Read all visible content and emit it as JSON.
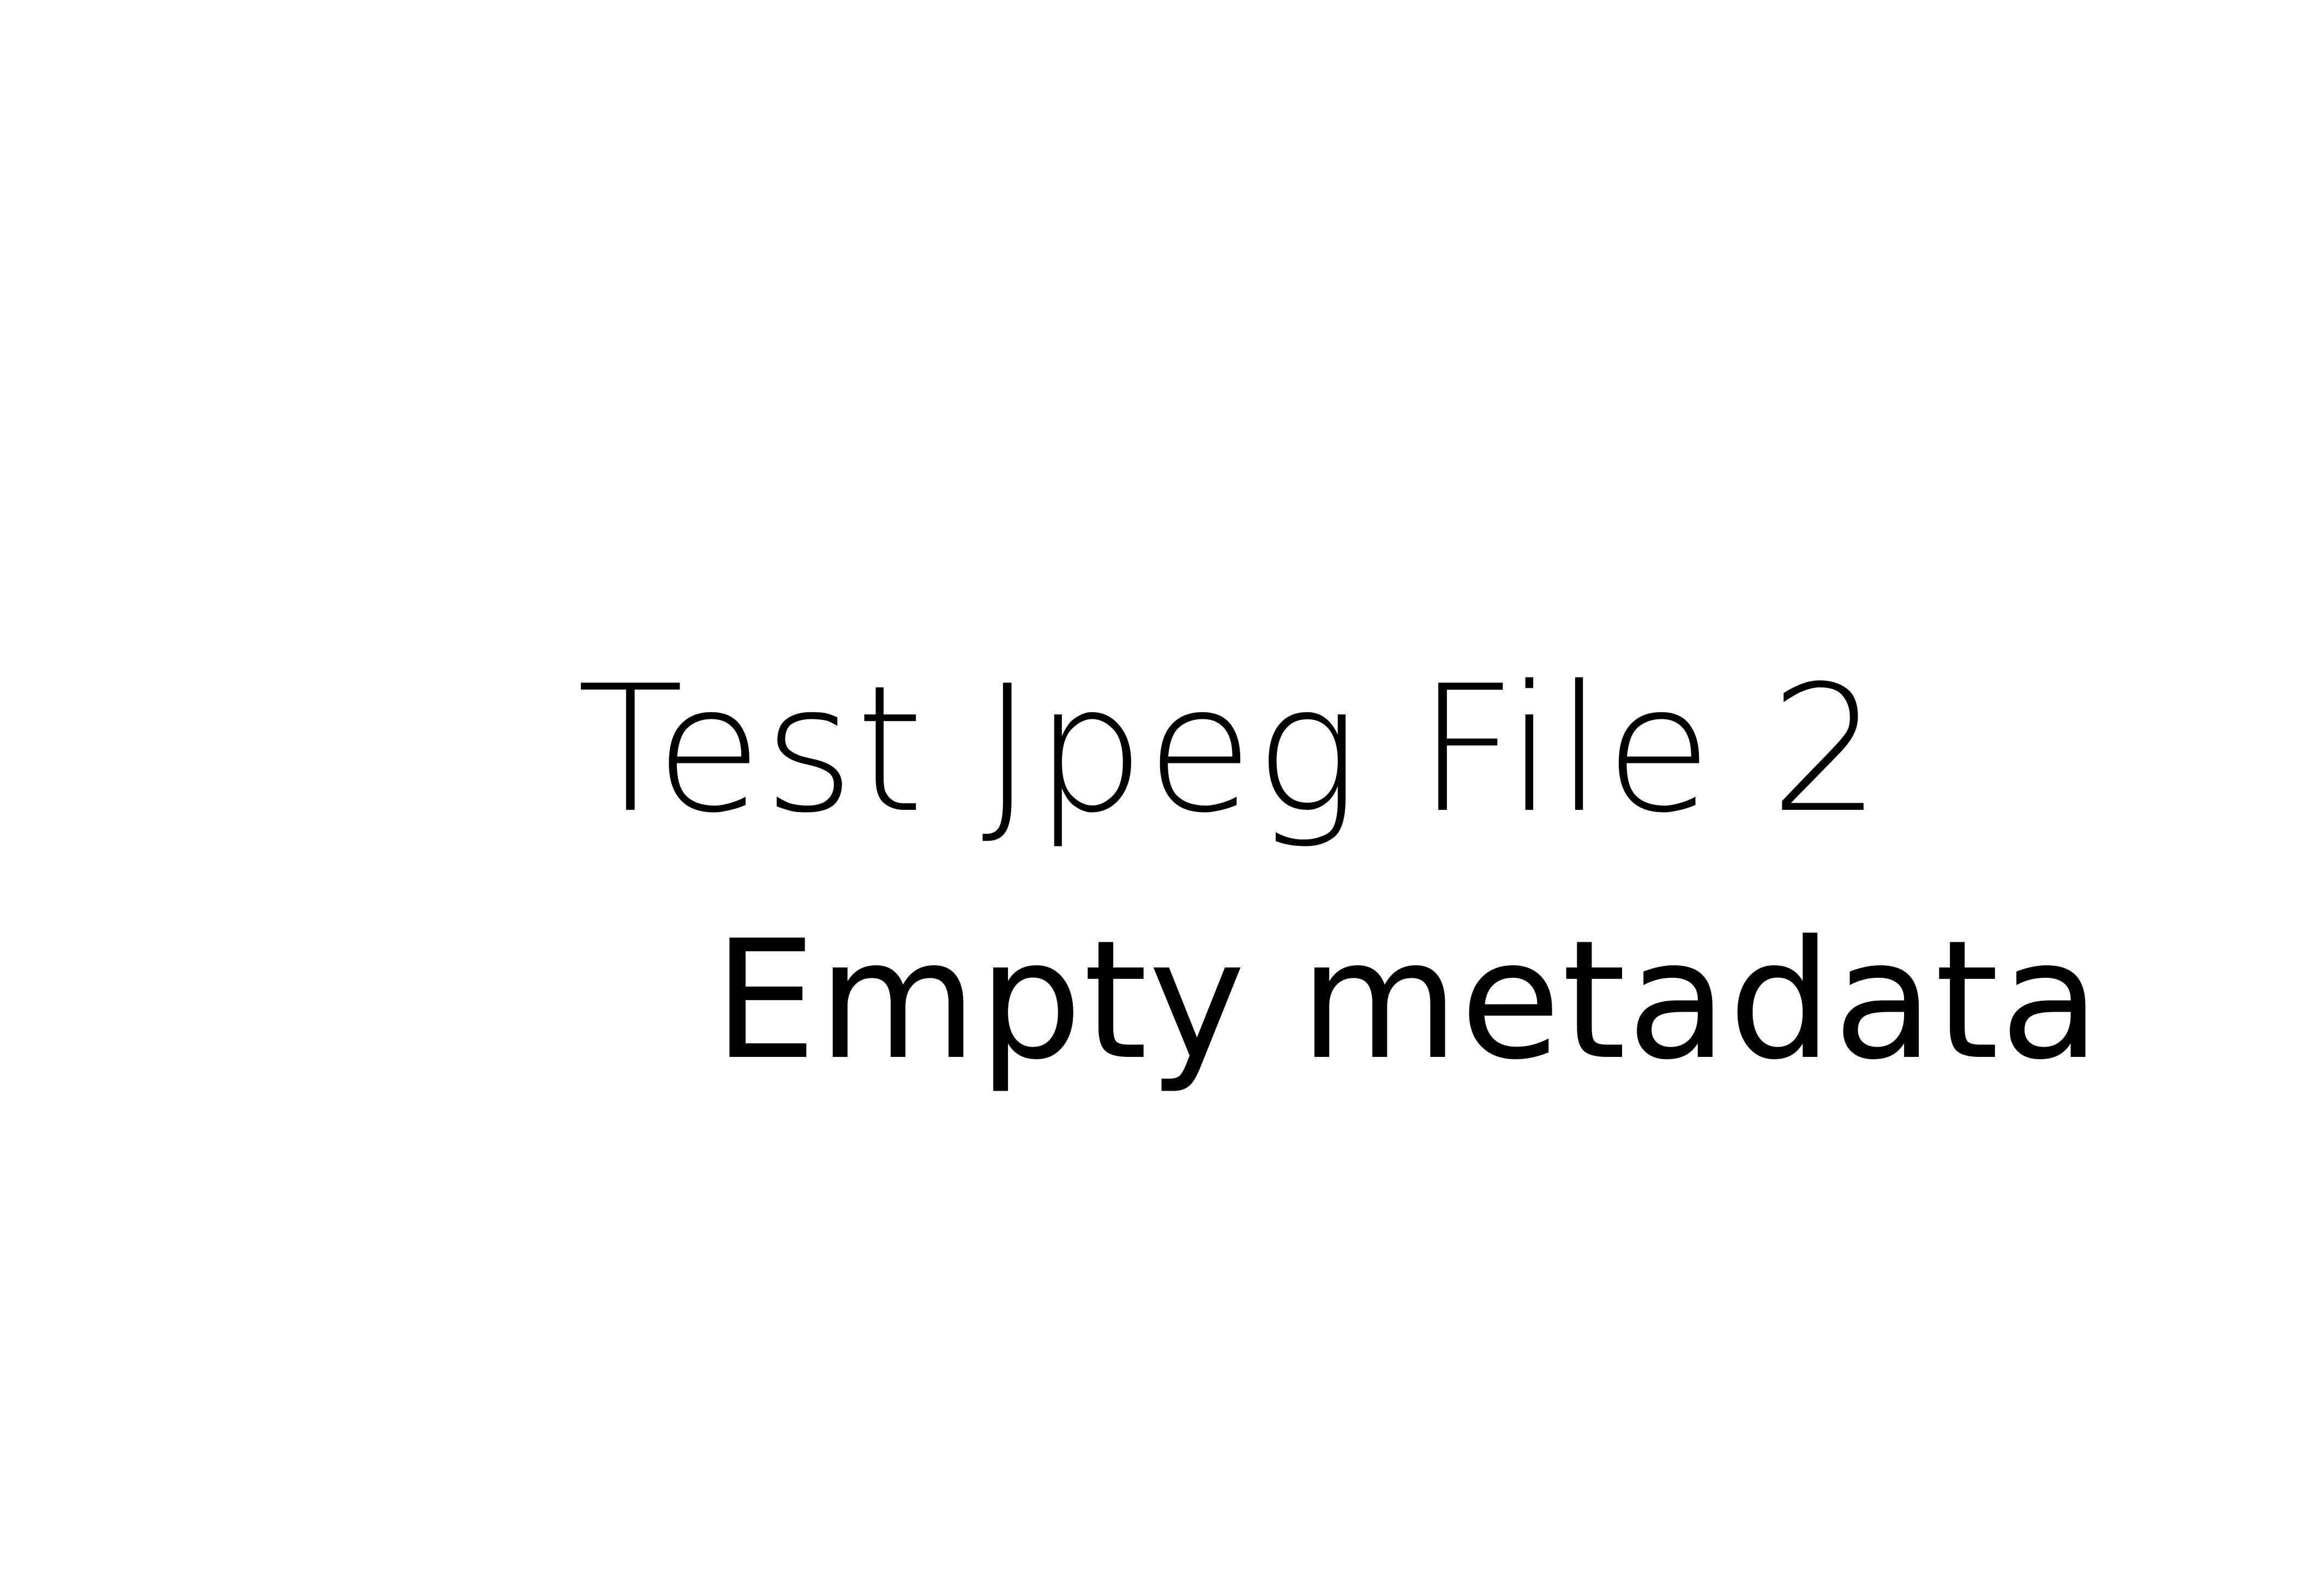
{
  "title": "Test Jpeg File 2",
  "subtitle": "Empty metadata",
  "colors": {
    "background": "#ffffff",
    "text": "#000000"
  }
}
